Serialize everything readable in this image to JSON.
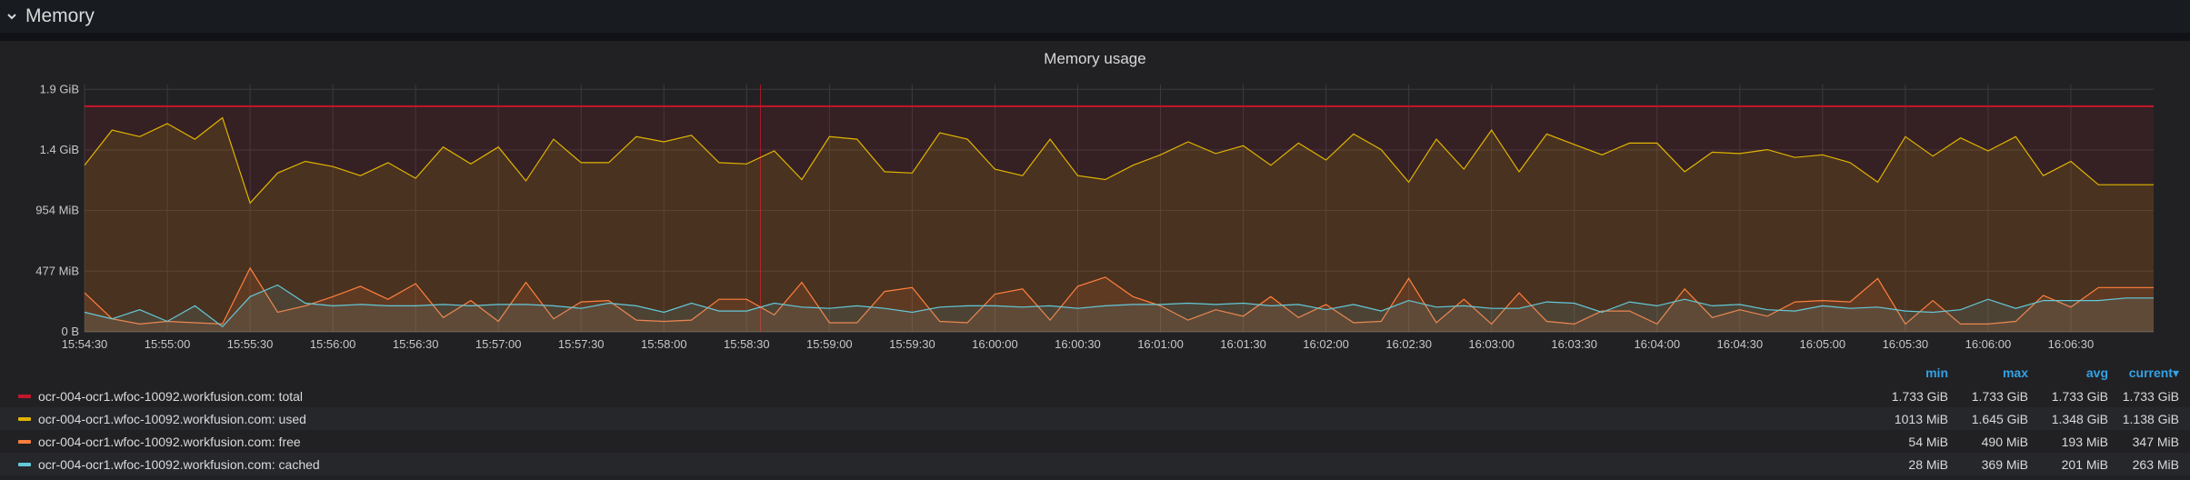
{
  "row": {
    "title": "Memory"
  },
  "panel": {
    "title": "Memory usage"
  },
  "colors": {
    "total": "#c4162a",
    "used": "#e0b400",
    "free": "#ff7f3e",
    "cached": "#64c8d8",
    "grid": "#3a3b3f",
    "axis_text": "#c7c7c7"
  },
  "chart_data": {
    "type": "area",
    "title": "Memory usage",
    "y_unit": "GiB",
    "ylim": [
      0,
      1.9
    ],
    "y_ticks": [
      {
        "value": 0,
        "label": "0 B"
      },
      {
        "value": 0.466,
        "label": "477 MiB"
      },
      {
        "value": 0.932,
        "label": "954 MiB"
      },
      {
        "value": 1.397,
        "label": "1.4 GiB"
      },
      {
        "value": 1.863,
        "label": "1.9 GiB"
      }
    ],
    "x_range": [
      "15:54:30",
      "16:07:00"
    ],
    "x_ticks": [
      "15:54:30",
      "15:55:00",
      "15:55:30",
      "15:56:00",
      "15:56:30",
      "15:57:00",
      "15:57:30",
      "15:58:00",
      "15:58:30",
      "15:59:00",
      "15:59:30",
      "16:00:00",
      "16:00:30",
      "16:01:00",
      "16:01:30",
      "16:02:00",
      "16:02:30",
      "16:03:00",
      "16:03:30",
      "16:04:00",
      "16:04:30",
      "16:05:00",
      "16:05:30",
      "16:06:00",
      "16:06:30"
    ],
    "grid": true,
    "annotation_time": "15:58:35",
    "sample_interval_seconds": 10,
    "series": [
      {
        "name": "ocr-004-ocr1.wfoc-10092.workfusion.com: total",
        "key": "total",
        "values": [
          1.733,
          1.733,
          1.733,
          1.733,
          1.733,
          1.733,
          1.733,
          1.733,
          1.733,
          1.733,
          1.733,
          1.733,
          1.733,
          1.733,
          1.733,
          1.733,
          1.733,
          1.733,
          1.733,
          1.733,
          1.733,
          1.733,
          1.733,
          1.733,
          1.733,
          1.733,
          1.733,
          1.733,
          1.733,
          1.733,
          1.733,
          1.733,
          1.733,
          1.733,
          1.733,
          1.733,
          1.733,
          1.733,
          1.733,
          1.733,
          1.733,
          1.733,
          1.733,
          1.733,
          1.733,
          1.733,
          1.733,
          1.733,
          1.733,
          1.733,
          1.733,
          1.733,
          1.733,
          1.733,
          1.733,
          1.733,
          1.733,
          1.733,
          1.733,
          1.733,
          1.733,
          1.733,
          1.733,
          1.733,
          1.733,
          1.733,
          1.733,
          1.733,
          1.733,
          1.733,
          1.733,
          1.733,
          1.733,
          1.733,
          1.733,
          1.733
        ]
      },
      {
        "name": "ocr-004-ocr1.wfoc-10092.workfusion.com: used",
        "key": "used",
        "values": [
          1.28,
          1.55,
          1.5,
          1.6,
          1.48,
          1.645,
          0.99,
          1.22,
          1.31,
          1.27,
          1.2,
          1.3,
          1.18,
          1.42,
          1.29,
          1.42,
          1.16,
          1.48,
          1.3,
          1.3,
          1.5,
          1.46,
          1.51,
          1.3,
          1.29,
          1.39,
          1.17,
          1.5,
          1.48,
          1.23,
          1.22,
          1.53,
          1.48,
          1.25,
          1.2,
          1.48,
          1.2,
          1.17,
          1.28,
          1.36,
          1.46,
          1.37,
          1.43,
          1.28,
          1.45,
          1.32,
          1.52,
          1.4,
          1.15,
          1.48,
          1.25,
          1.55,
          1.23,
          1.52,
          1.44,
          1.36,
          1.45,
          1.45,
          1.23,
          1.38,
          1.37,
          1.4,
          1.34,
          1.36,
          1.3,
          1.15,
          1.5,
          1.35,
          1.49,
          1.39,
          1.5,
          1.2,
          1.31,
          1.13,
          1.13,
          1.13
        ]
      },
      {
        "name": "ocr-004-ocr1.wfoc-10092.workfusion.com: free",
        "key": "free",
        "values": [
          0.3,
          0.1,
          0.06,
          0.08,
          0.07,
          0.06,
          0.49,
          0.15,
          0.2,
          0.27,
          0.35,
          0.25,
          0.37,
          0.11,
          0.24,
          0.08,
          0.38,
          0.1,
          0.23,
          0.24,
          0.09,
          0.08,
          0.09,
          0.25,
          0.25,
          0.13,
          0.38,
          0.07,
          0.07,
          0.31,
          0.34,
          0.08,
          0.07,
          0.29,
          0.33,
          0.09,
          0.35,
          0.42,
          0.27,
          0.2,
          0.09,
          0.17,
          0.12,
          0.27,
          0.11,
          0.21,
          0.07,
          0.08,
          0.41,
          0.07,
          0.25,
          0.06,
          0.3,
          0.08,
          0.06,
          0.16,
          0.16,
          0.06,
          0.33,
          0.11,
          0.17,
          0.12,
          0.23,
          0.24,
          0.23,
          0.41,
          0.06,
          0.24,
          0.06,
          0.06,
          0.08,
          0.28,
          0.19,
          0.34,
          0.34,
          0.34
        ]
      },
      {
        "name": "ocr-004-ocr1.wfoc-10092.workfusion.com: cached",
        "key": "cached",
        "values": [
          0.15,
          0.1,
          0.17,
          0.08,
          0.2,
          0.04,
          0.27,
          0.36,
          0.22,
          0.2,
          0.21,
          0.2,
          0.2,
          0.21,
          0.2,
          0.21,
          0.21,
          0.2,
          0.18,
          0.22,
          0.2,
          0.15,
          0.22,
          0.16,
          0.16,
          0.22,
          0.19,
          0.18,
          0.2,
          0.18,
          0.15,
          0.19,
          0.2,
          0.2,
          0.19,
          0.2,
          0.18,
          0.2,
          0.21,
          0.21,
          0.22,
          0.21,
          0.22,
          0.2,
          0.21,
          0.17,
          0.21,
          0.16,
          0.24,
          0.19,
          0.2,
          0.18,
          0.18,
          0.23,
          0.22,
          0.15,
          0.23,
          0.2,
          0.25,
          0.2,
          0.21,
          0.17,
          0.16,
          0.2,
          0.18,
          0.19,
          0.16,
          0.15,
          0.17,
          0.25,
          0.18,
          0.24,
          0.24,
          0.24,
          0.26,
          0.26
        ]
      }
    ]
  },
  "legend": {
    "headers": {
      "min": "min",
      "max": "max",
      "avg": "avg",
      "current": "current"
    },
    "sort_indicator": "▾",
    "rows": [
      {
        "key": "total",
        "name": "ocr-004-ocr1.wfoc-10092.workfusion.com: total",
        "min": "1.733 GiB",
        "max": "1.733 GiB",
        "avg": "1.733 GiB",
        "current": "1.733 GiB"
      },
      {
        "key": "used",
        "name": "ocr-004-ocr1.wfoc-10092.workfusion.com: used",
        "min": "1013 MiB",
        "max": "1.645 GiB",
        "avg": "1.348 GiB",
        "current": "1.138 GiB"
      },
      {
        "key": "free",
        "name": "ocr-004-ocr1.wfoc-10092.workfusion.com: free",
        "min": "54 MiB",
        "max": "490 MiB",
        "avg": "193 MiB",
        "current": "347 MiB"
      },
      {
        "key": "cached",
        "name": "ocr-004-ocr1.wfoc-10092.workfusion.com: cached",
        "min": "28 MiB",
        "max": "369 MiB",
        "avg": "201 MiB",
        "current": "263 MiB"
      }
    ]
  }
}
